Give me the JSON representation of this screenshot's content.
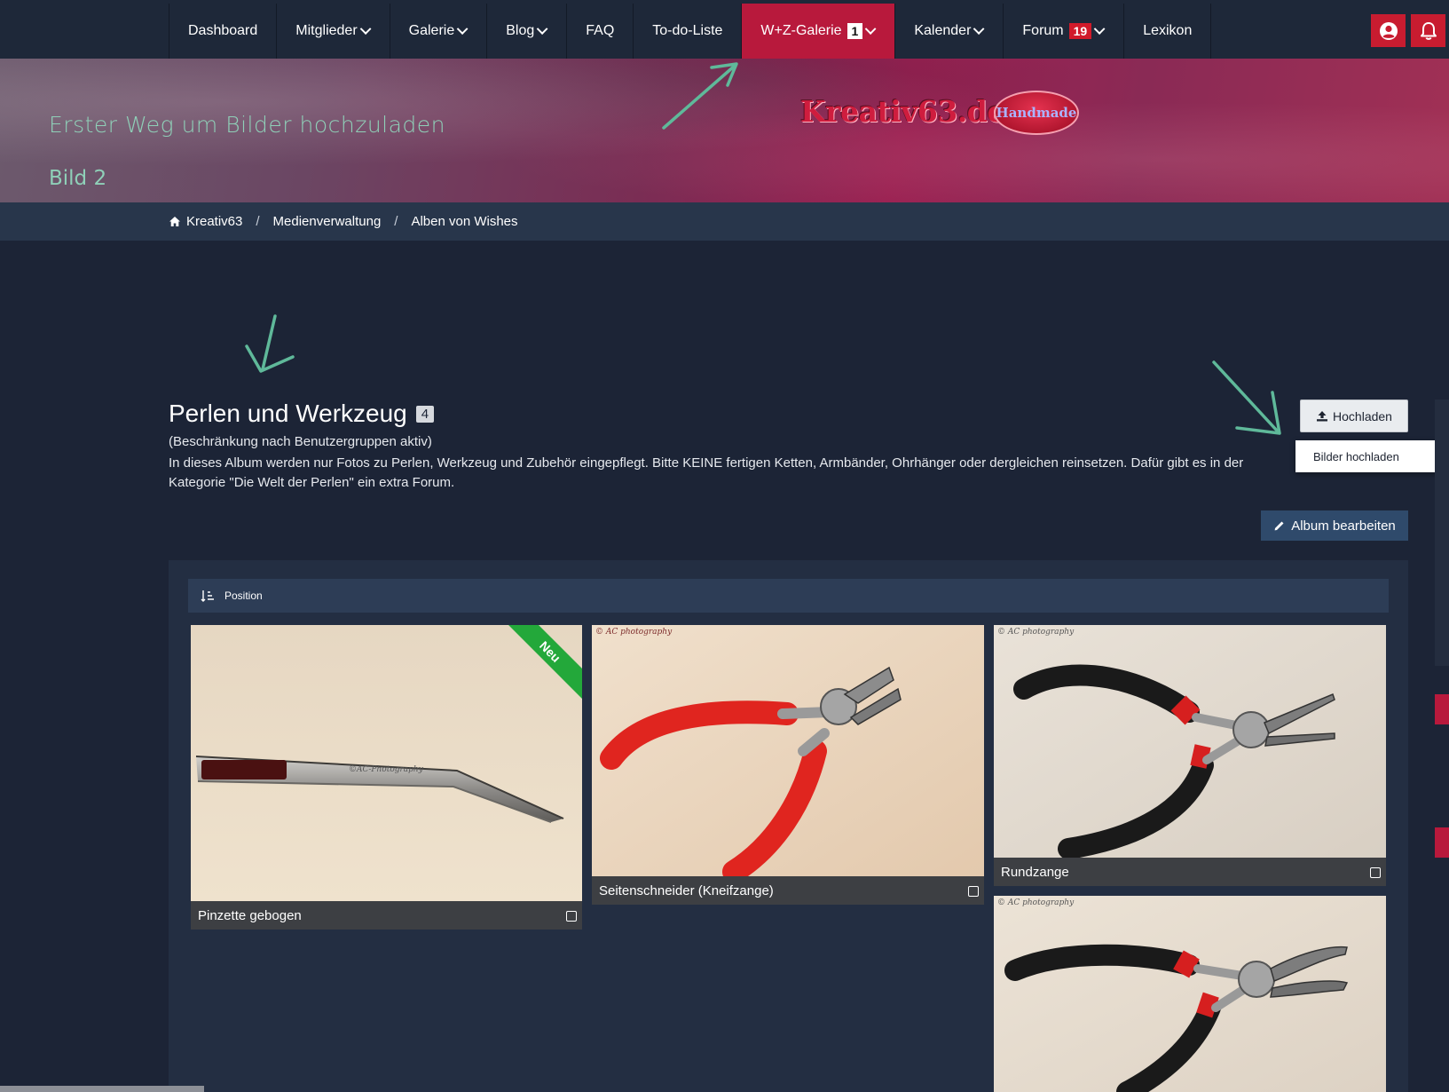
{
  "nav": {
    "items": [
      {
        "label": "Dashboard",
        "dropdown": false
      },
      {
        "label": "Mitglieder",
        "dropdown": true
      },
      {
        "label": "Galerie",
        "dropdown": true
      },
      {
        "label": "Blog",
        "dropdown": true
      },
      {
        "label": "FAQ",
        "dropdown": false
      },
      {
        "label": "To-do-Liste",
        "dropdown": false
      },
      {
        "label": "W+Z-Galerie",
        "dropdown": true,
        "badge": "1",
        "active": true
      },
      {
        "label": "Kalender",
        "dropdown": true
      },
      {
        "label": "Forum",
        "dropdown": true,
        "badge": "19"
      },
      {
        "label": "Lexikon",
        "dropdown": false
      }
    ],
    "user_icon": "user-circle-icon",
    "bell_icon": "bell-icon",
    "accent": "#b8193c"
  },
  "banner": {
    "line1": "Erster Weg um Bilder hochzuladen",
    "line2": "Bild 2",
    "logo": "Kreativ63.de",
    "badge": "Handmade"
  },
  "breadcrumb": {
    "icon": "home-icon",
    "items": [
      "Kreativ63",
      "Medienverwaltung",
      "Alben von Wishes"
    ],
    "separator": "/"
  },
  "album": {
    "title": "Perlen und Werkzeug",
    "count": "4",
    "note": "(Beschränkung nach Benutzergruppen aktiv)",
    "description": "In dieses Album werden nur Fotos zu Perlen, Werkzeug und Zubehör eingepflegt. Bitte KEINE fertigen Ketten, Armbänder, Ohrhänger oder dergleichen reinsetzen. Dafür gibt es in der Kategorie \"Die Welt der Perlen\" ein extra Forum.",
    "upload_label": "Hochladen",
    "upload_menu_item": "Bilder hochladen",
    "edit_label": "Album bearbeiten"
  },
  "sort": {
    "label": "Position",
    "icon": "sort-ascending-icon"
  },
  "images": [
    {
      "caption": "Pinzette gebogen",
      "badge": "Neu",
      "watermark": "©AC-Photography"
    },
    {
      "caption": "Seitenschneider (Kneifzange)",
      "watermark": "© AC photography"
    },
    {
      "caption": "Rundzange",
      "watermark": "© AC photography"
    },
    {
      "caption": "",
      "watermark": "© AC photography"
    }
  ]
}
